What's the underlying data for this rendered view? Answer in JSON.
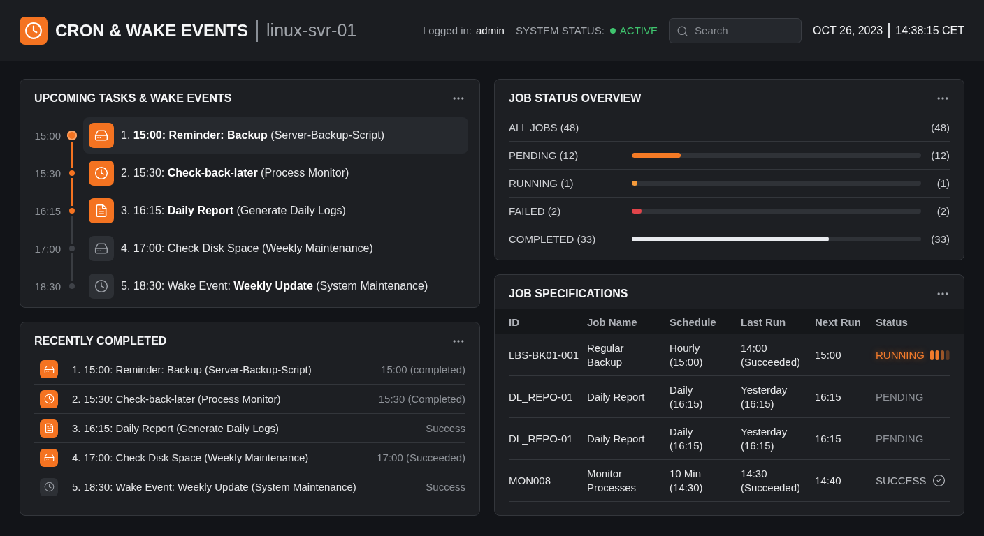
{
  "header": {
    "title": "CRON & WAKE EVENTS",
    "host": "linux-svr-01",
    "logged_in": {
      "label": "Logged in:",
      "user": "admin"
    },
    "system_status": {
      "label": "SYSTEM STATUS:",
      "value": "ACTIVE"
    },
    "search": {
      "placeholder": "Search"
    },
    "date": "OCT 26, 2023",
    "time": "14:38:15 CET"
  },
  "upcoming": {
    "title": "UPCOMING TASKS & WAKE EVENTS",
    "items": [
      {
        "time": "15:00",
        "kind": "drive",
        "active": true,
        "selected": true,
        "text": "1. **15:00: Reminder: Backup** (Server-Backup-Script)"
      },
      {
        "time": "15:30",
        "kind": "clock",
        "active": true,
        "selected": false,
        "text": "2. 15:30: **Check-back-later** (Process Monitor)"
      },
      {
        "time": "16:15",
        "kind": "document",
        "active": true,
        "selected": false,
        "text": "3. 16:15: **Daily Report** (Generate Daily Logs)"
      },
      {
        "time": "17:00",
        "kind": "drive",
        "active": false,
        "selected": false,
        "text": "4. 17:00: Check Disk Space (Weekly Maintenance)"
      },
      {
        "time": "18:30",
        "kind": "clock",
        "active": false,
        "selected": false,
        "text": "5. 18:30: Wake Event: **Weekly Update** (System Maintenance)"
      }
    ]
  },
  "recent": {
    "title": "RECENTLY COMPLETED",
    "items": [
      {
        "kind": "drive",
        "active": true,
        "text": "1. 15:00: Reminder: Backup (Server-Backup-Script)",
        "status": "15:00 (completed)"
      },
      {
        "kind": "clock",
        "active": true,
        "text": "2. 15:30: Check-back-later (Process Monitor)",
        "status": "15:30 (Completed)"
      },
      {
        "kind": "document",
        "active": true,
        "text": "3. 16:15: Daily Report (Generate Daily Logs)",
        "status": "Success"
      },
      {
        "kind": "drive",
        "active": true,
        "text": "4. 17:00: Check Disk Space (Weekly Maintenance)",
        "status": "17:00 (Succeeded)"
      },
      {
        "kind": "clock",
        "active": false,
        "text": "5. 18:30: Wake Event: Weekly Update (System Maintenance)",
        "status": "Success"
      }
    ]
  },
  "overview": {
    "title": "JOB STATUS OVERVIEW",
    "rows": [
      {
        "kind": "total",
        "label": "ALL JOBS (48)",
        "count": "(48)"
      },
      {
        "kind": "bar",
        "label": "PENDING (12)",
        "count": "(12)",
        "level": 0.17,
        "color": "#f47a25"
      },
      {
        "kind": "bar",
        "label": "RUNNING (1)",
        "count": "(1)",
        "level": 0.02,
        "color": "#f59a3a"
      },
      {
        "kind": "bar",
        "label": "FAILED (2)",
        "count": "(2)",
        "level": 0.035,
        "color": "#e0444a"
      },
      {
        "kind": "bar",
        "label": "COMPLETED (33)",
        "count": "(33)",
        "level": 0.68,
        "color": "#e8eaee"
      }
    ]
  },
  "specs": {
    "title": "JOB SPECIFICATIONS",
    "columns": [
      "ID",
      "Job Name",
      "Schedule",
      "Last Run",
      "Next Run",
      "Status"
    ],
    "rows": [
      {
        "id": "LBS-BK01-001",
        "job_name": "Regular Backup",
        "schedule": "Hourly (15:00)",
        "last_run": "14:00 (Succeeded)",
        "next_run": "15:00",
        "status": {
          "kind": "running",
          "label": "RUNNING"
        }
      },
      {
        "id": "DL_REPO-01",
        "job_name": "Daily Report",
        "schedule": "Daily (16:15)",
        "last_run": "Yesterday (16:15)",
        "next_run": "16:15",
        "status": {
          "kind": "pending",
          "label": "PENDING"
        }
      },
      {
        "id": "DL_REPO-01",
        "job_name": "Daily Report",
        "schedule": "Daily (16:15)",
        "last_run": "Yesterday (16:15)",
        "next_run": "16:15",
        "status": {
          "kind": "pending",
          "label": "PENDING"
        }
      },
      {
        "id": "MON008",
        "job_name": "Monitor Processes",
        "schedule": "10 Min (14:30)",
        "last_run": "14:30 (Succeeded)",
        "next_run": "14:40",
        "status": {
          "kind": "success",
          "label": "SUCCESS"
        }
      }
    ]
  }
}
